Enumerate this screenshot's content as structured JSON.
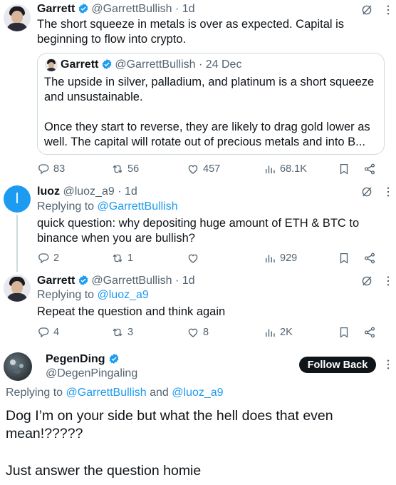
{
  "tweet1": {
    "name": "Garrett",
    "handle": "@GarrettBullish",
    "time": "· 1d",
    "text": "The short squeeze in metals is over as expected. Capital is beginning to flow into crypto.",
    "quote": {
      "name": "Garrett",
      "handle": "@GarrettBullish",
      "time": "· 24 Dec",
      "text1": "The upside in silver, palladium, and platinum is a short squeeze and unsustainable.",
      "text2": "Once they start to reverse, they are likely to drag gold lower as well. The capital will rotate out of precious metals and into B..."
    },
    "stats": {
      "replies": "83",
      "reposts": "56",
      "likes": "457",
      "views": "68.1K"
    }
  },
  "tweet2": {
    "avatar_letter": "l",
    "name": "luoz",
    "handle": "@luoz_a9",
    "time": "· 1d",
    "replying_prefix": "Replying to",
    "replying_to": "@GarrettBullish",
    "text": "quick question: why depositing huge amount of ETH & BTC to binance when you are bullish?",
    "stats": {
      "replies": "2",
      "reposts": "1",
      "likes": "",
      "views": "929"
    }
  },
  "tweet3": {
    "name": "Garrett",
    "handle": "@GarrettBullish",
    "time": "· 1d",
    "replying_prefix": "Replying to",
    "replying_to": "@luoz_a9",
    "text": "Repeat the question and think again",
    "stats": {
      "replies": "4",
      "reposts": "3",
      "likes": "8",
      "views": "2K"
    }
  },
  "tweet4": {
    "name": "PegenDing",
    "handle": "@DegenPingaling",
    "follow_label": "Follow Back",
    "replying_prefix": "Replying to",
    "replying_to_1": "@GarrettBullish",
    "replying_and": "and",
    "replying_to_2": "@luoz_a9",
    "text1": "Dog I’m on your side but what the hell does that even mean!?????",
    "text2": "Just answer the question homie"
  },
  "colors": {
    "accent": "#1d9bf0",
    "text": "#0f1419",
    "muted": "#536471",
    "border": "#cfd9de"
  },
  "icons": [
    "verified-badge-icon",
    "grok-icon",
    "more-icon",
    "reply-icon",
    "repost-icon",
    "like-icon",
    "views-icon",
    "bookmark-icon",
    "share-icon"
  ]
}
